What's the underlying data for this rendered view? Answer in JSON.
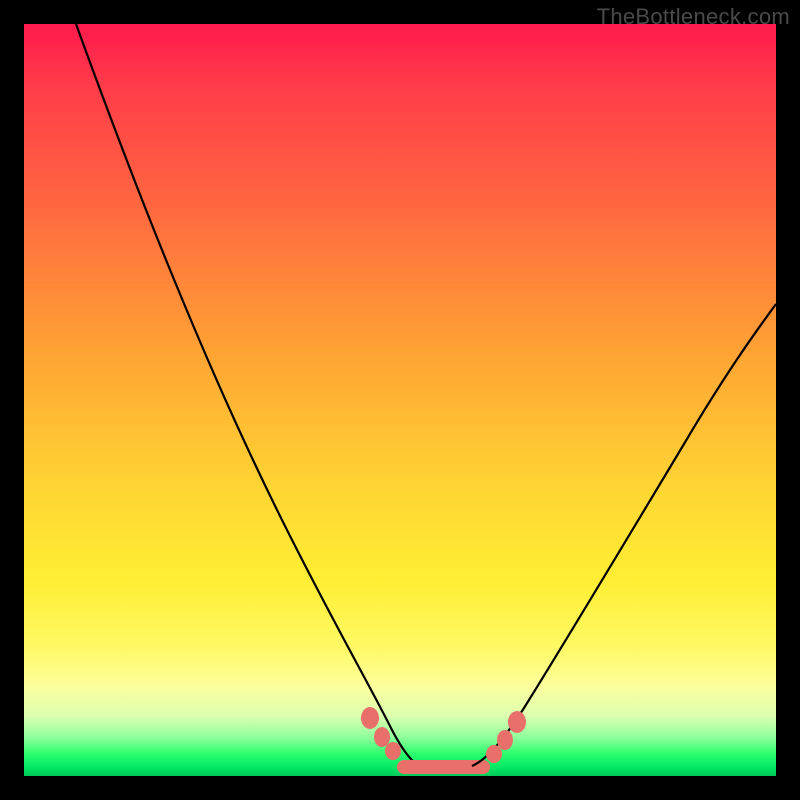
{
  "watermark": "TheBottleneck.com",
  "colors": {
    "frame": "#000000",
    "curve": "#000000",
    "marker": "#e96f6a",
    "gradient_top": "#ff1a4d",
    "gradient_mid": "#ffee33",
    "gradient_bottom": "#00c858"
  },
  "chart_data": {
    "type": "line",
    "title": "",
    "xlabel": "",
    "ylabel": "",
    "xlim": [
      0,
      100
    ],
    "ylim": [
      0,
      100
    ],
    "grid": false,
    "legend": false,
    "series": [
      {
        "name": "left-curve",
        "x": [
          7,
          12,
          18,
          24,
          30,
          35,
          40,
          44,
          47,
          49,
          51,
          53
        ],
        "y": [
          100,
          85,
          68,
          52,
          38,
          27,
          18,
          11,
          6,
          3,
          1.2,
          0
        ]
      },
      {
        "name": "right-curve",
        "x": [
          60,
          63,
          67,
          72,
          78,
          85,
          92,
          100
        ],
        "y": [
          0,
          1.5,
          5,
          12,
          22,
          35,
          49,
          62
        ]
      },
      {
        "name": "bottom-flat",
        "x": [
          49,
          60
        ],
        "y": [
          0,
          0
        ]
      }
    ],
    "markers": {
      "name": "highlight-dots",
      "x": [
        44.8,
        46.3,
        47.8,
        61.0,
        62.5,
        63.8
      ],
      "y": [
        6.5,
        4.0,
        2.2,
        1.8,
        3.6,
        6.0
      ]
    },
    "marker_pill": {
      "x_start": 49,
      "x_end": 60,
      "y": 0
    }
  }
}
